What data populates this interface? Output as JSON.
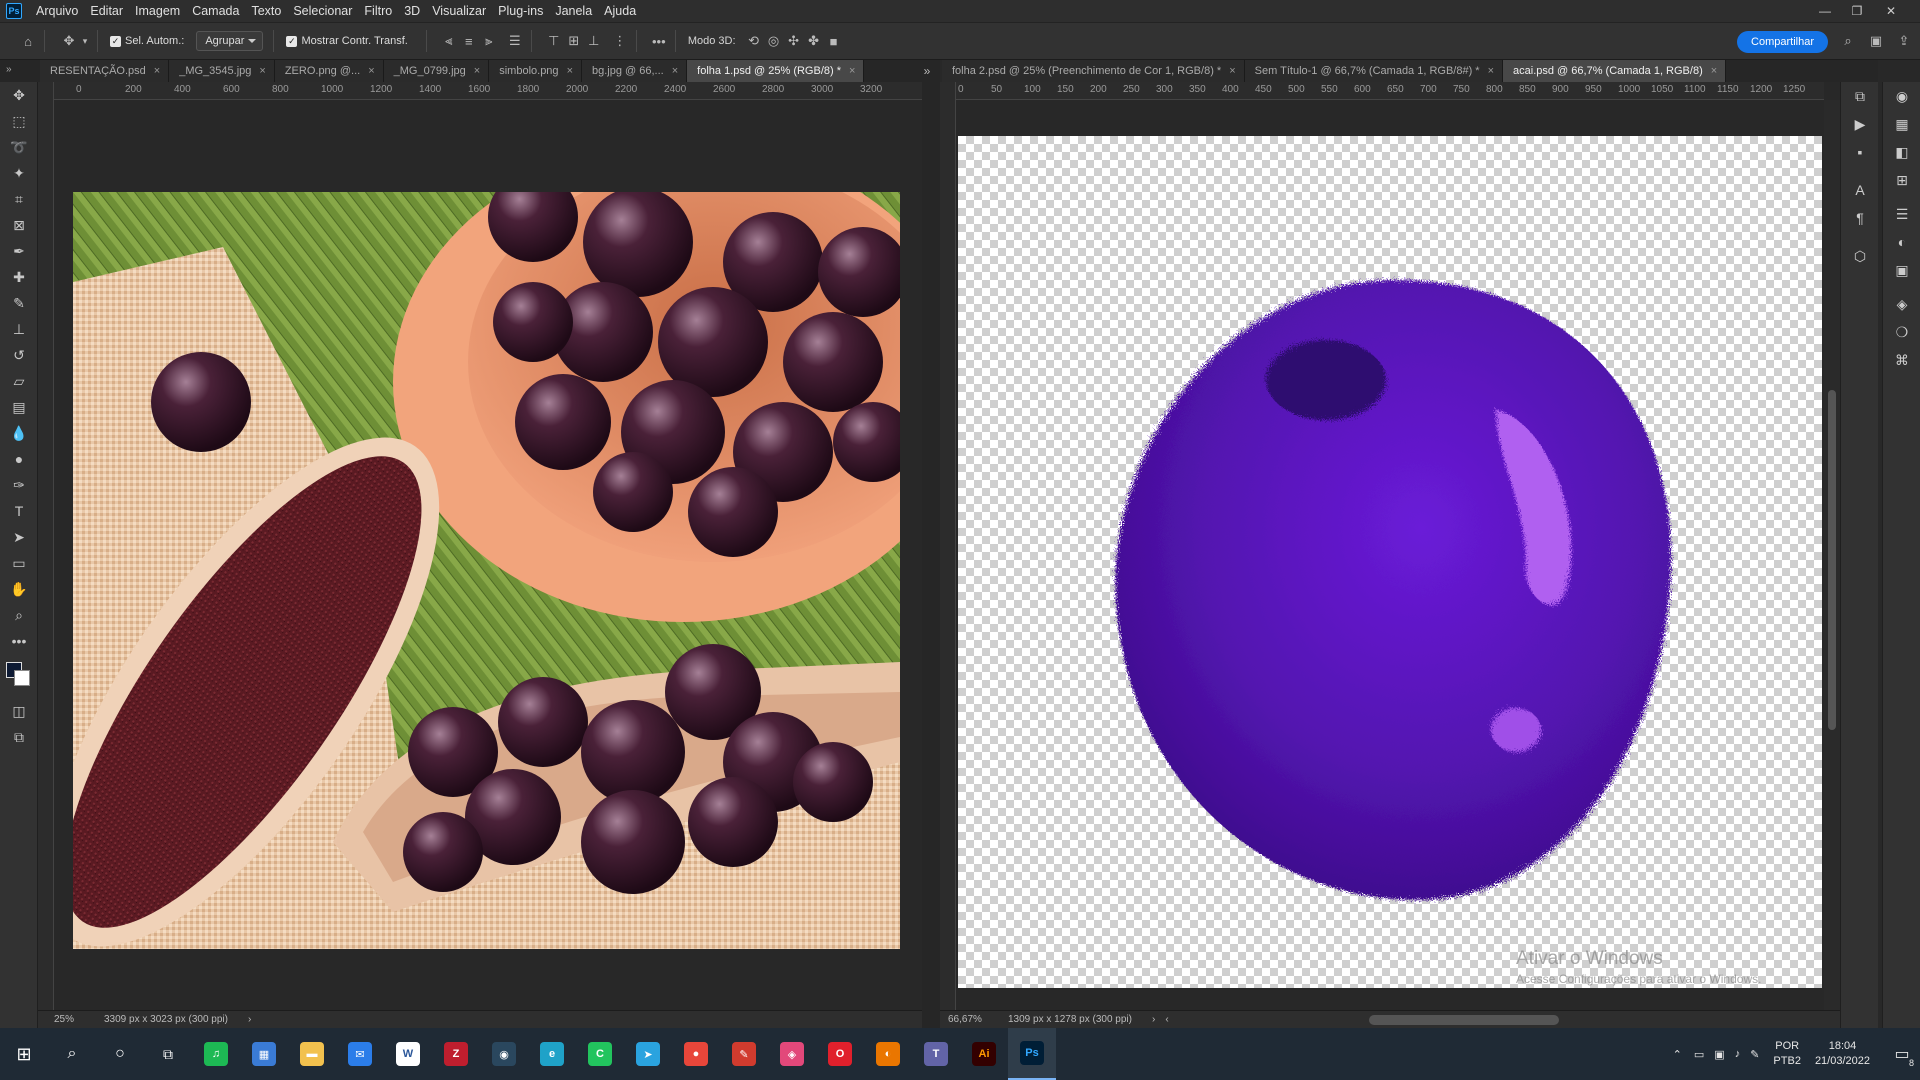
{
  "menubar": {
    "logo": "Ps",
    "items": [
      "Arquivo",
      "Editar",
      "Imagem",
      "Camada",
      "Texto",
      "Selecionar",
      "Filtro",
      "3D",
      "Visualizar",
      "Plug-ins",
      "Janela",
      "Ajuda"
    ]
  },
  "options": {
    "auto_select_label": "Sel. Autom.:",
    "group_value": "Agrupar",
    "transform_label": "Mostrar Contr. Transf.",
    "mode3d_label": "Modo 3D:",
    "share_label": "Compartilhar"
  },
  "left_tabs": [
    {
      "label": "RESENTAÇÃO.psd",
      "active": false
    },
    {
      "label": "_MG_3545.jpg",
      "active": false
    },
    {
      "label": "ZERO.png @...",
      "active": false
    },
    {
      "label": "_MG_0799.jpg",
      "active": false
    },
    {
      "label": "simbolo.png",
      "active": false
    },
    {
      "label": "bg.jpg @ 66,...",
      "active": false
    },
    {
      "label": "folha 1.psd @ 25% (RGB/8) *",
      "active": false
    }
  ],
  "overflow_icon": "double-chevron-right-icon",
  "right_tabs": [
    {
      "label": "folha 2.psd @ 25% (Preenchimento de Cor 1, RGB/8) *",
      "active": false
    },
    {
      "label": "Sem Título-1 @ 66,7% (Camada 1, RGB/8#) *",
      "active": false
    },
    {
      "label": "acai.psd @ 66,7% (Camada 1, RGB/8)",
      "active": true
    }
  ],
  "left_ruler_ticks": [
    "0",
    "200",
    "400",
    "600",
    "800",
    "1000",
    "1200",
    "1400",
    "1600",
    "1800",
    "2000",
    "2200",
    "2400",
    "2600",
    "2800",
    "3000",
    "3200"
  ],
  "right_ruler_ticks": [
    "0",
    "50",
    "100",
    "150",
    "200",
    "250",
    "300",
    "350",
    "400",
    "450",
    "500",
    "550",
    "600",
    "650",
    "700",
    "750",
    "800",
    "850",
    "900",
    "950",
    "1000",
    "1050",
    "1100",
    "1150",
    "1200",
    "1250"
  ],
  "left_status": {
    "zoom": "25%",
    "info": "3309 px x 3023 px (300 ppi)"
  },
  "right_status": {
    "zoom": "66,67%",
    "info": "1309 px x 1278 px (300 ppi)"
  },
  "watermark": {
    "title": "Ativar o Windows",
    "subtitle": "Acesse Configurações para ativar o Windows."
  },
  "taskbar": {
    "apps": [
      {
        "name": "spotify-icon",
        "color": "#1db954",
        "glyph": "♫"
      },
      {
        "name": "store-icon",
        "color": "#3a7bd5",
        "glyph": "▦"
      },
      {
        "name": "folder-icon",
        "color": "#f2c14e",
        "glyph": "▬"
      },
      {
        "name": "mail-icon",
        "color": "#2b7de9",
        "glyph": "✉"
      },
      {
        "name": "word-icon",
        "color": "#ffffff",
        "glyph": "W"
      },
      {
        "name": "filezilla-icon",
        "color": "#bf1e2e",
        "glyph": "Z"
      },
      {
        "name": "steam-icon",
        "color": "#2a475e",
        "glyph": "◉"
      },
      {
        "name": "edge-icon",
        "color": "#1fa2c8",
        "glyph": "e"
      },
      {
        "name": "cart-icon",
        "color": "#22c45e",
        "glyph": "C"
      },
      {
        "name": "telegram-icon",
        "color": "#2aa3df",
        "glyph": "➤"
      },
      {
        "name": "chrome-icon",
        "color": "#e8463a",
        "glyph": "●"
      },
      {
        "name": "paint-icon",
        "color": "#d13b2e",
        "glyph": "✎"
      },
      {
        "name": "photos-icon",
        "color": "#e2487a",
        "glyph": "◈"
      },
      {
        "name": "opera-icon",
        "color": "#e0202c",
        "glyph": "O"
      },
      {
        "name": "blender-icon",
        "color": "#ea7600",
        "glyph": "◐"
      },
      {
        "name": "teams-icon",
        "color": "#6264a7",
        "glyph": "T"
      },
      {
        "name": "illustrator-icon",
        "color": "#330000",
        "glyph": "Ai"
      },
      {
        "name": "photoshop-icon",
        "color": "#001e36",
        "glyph": "Ps"
      }
    ],
    "lang_top": "POR",
    "lang_bottom": "PTB2",
    "time": "18:04",
    "date": "21/03/2022",
    "notification_count": "8"
  }
}
